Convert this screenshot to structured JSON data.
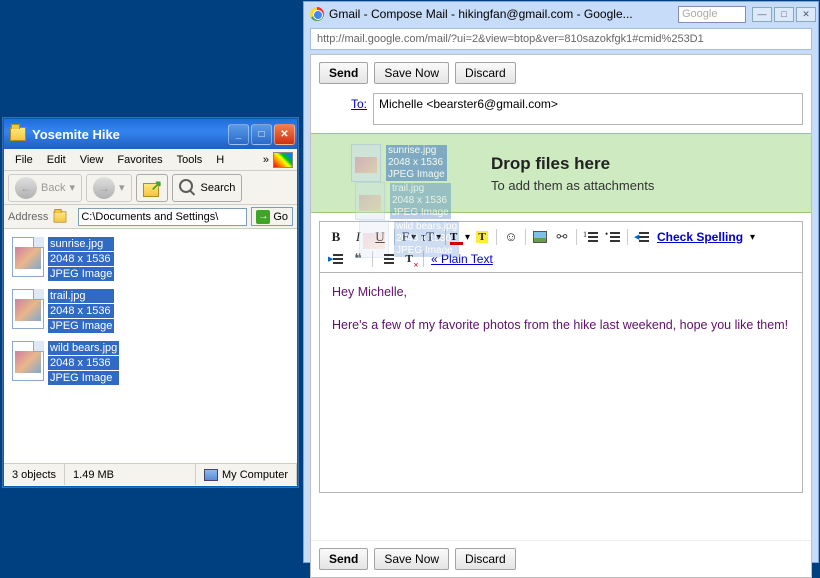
{
  "explorer": {
    "title": "Yosemite Hike",
    "menu": [
      "File",
      "Edit",
      "View",
      "Favorites",
      "Tools",
      "H"
    ],
    "back": "Back",
    "search": "Search",
    "address_label": "Address",
    "address_path": "C:\\Documents and Settings\\",
    "go": "Go",
    "files": [
      {
        "name": "sunrise.jpg",
        "dim": "2048 x 1536",
        "kind": "JPEG Image"
      },
      {
        "name": "trail.jpg",
        "dim": "2048 x 1536",
        "kind": "JPEG Image"
      },
      {
        "name": "wild bears.jpg",
        "dim": "2048 x 1536",
        "kind": "JPEG Image"
      }
    ],
    "status_objects": "3 objects",
    "status_size": "1.49 MB",
    "status_location": "My Computer"
  },
  "gmail": {
    "window_title": "Gmail - Compose Mail - hikingfan@gmail.com - Google...",
    "searchbox_placeholder": "Google",
    "url": "http://mail.google.com/mail/?ui=2&view=btop&ver=810sazokfgk1#cmid%253D1",
    "buttons": {
      "send": "Send",
      "save": "Save Now",
      "discard": "Discard"
    },
    "to_label": "To:",
    "to_value": "Michelle <bearster6@gmail.com>",
    "drop_title": "Drop files here",
    "drop_sub": "To add them as attachments",
    "ghost_files": [
      {
        "name": "sunrise.jpg",
        "dim": "2048 x 1536",
        "kind": "JPEG Image"
      },
      {
        "name": "trail.jpg",
        "dim": "2048 x 1536",
        "kind": "JPEG Image"
      },
      {
        "name": "wild bears.jpg",
        "dim": "2048 x 1536",
        "kind": "JPEG Image"
      }
    ],
    "check_spelling": "Check Spelling",
    "plain_text": "« Plain Text",
    "body_lines": [
      "Hey Michelle,",
      "Here's a few of my favorite photos from the hike last weekend, hope you like them!"
    ]
  }
}
